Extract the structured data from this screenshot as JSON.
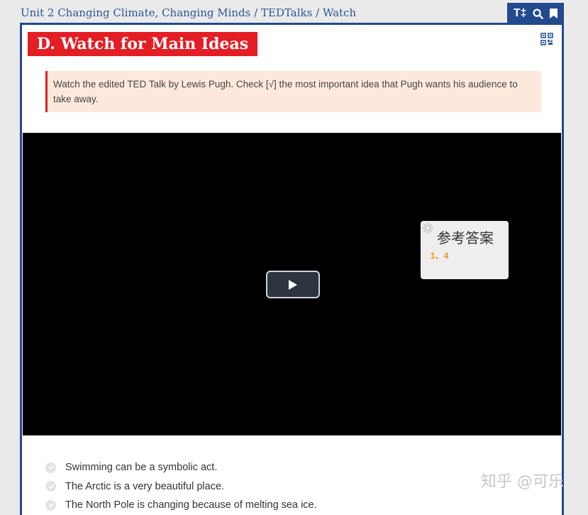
{
  "breadcrumb": {
    "unit": "Unit 2 Changing Climate, Changing Minds",
    "sep": "/",
    "section": "TEDTalks",
    "page": "Watch"
  },
  "toolbar": {
    "text_size_label": "T‡"
  },
  "card": {
    "title": "D. Watch for Main Ideas",
    "instruction": "Watch the edited TED Talk by Lewis Pugh. Check [√] the most important idea that Pugh wants his audience to take away."
  },
  "answer_popup": {
    "title": "参考答案",
    "value": "1、4"
  },
  "options": [
    {
      "text": "Swimming can be a symbolic act."
    },
    {
      "text": "The Arctic is a very beautiful place."
    },
    {
      "text": "The North Pole is changing because of melting sea ice."
    }
  ],
  "watermark": "知乎 @可乐",
  "colors": {
    "accent_blue": "#214a8f",
    "title_red": "#e31e24",
    "instruction_bg": "#fde9dc",
    "answer_orange": "#e89a16"
  }
}
